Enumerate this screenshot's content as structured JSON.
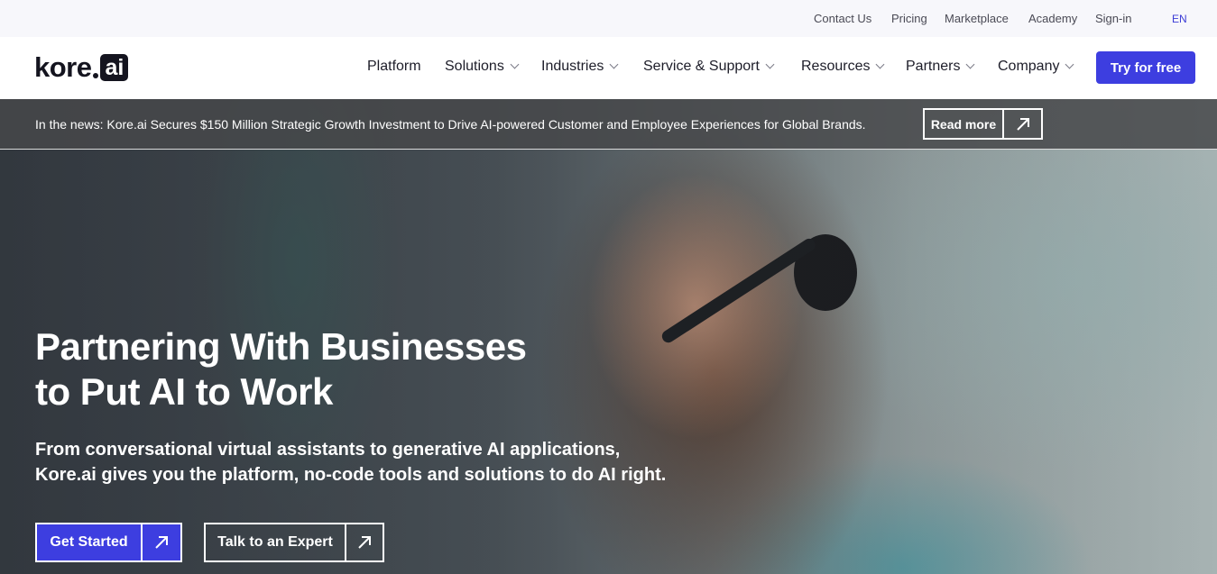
{
  "utility_nav": {
    "contact": "Contact Us",
    "pricing": "Pricing",
    "marketplace": "Marketplace",
    "academy": "Academy",
    "signin": "Sign-in",
    "language": "EN"
  },
  "header": {
    "logo": {
      "brand": "kore",
      "suffix": "ai"
    },
    "nav": {
      "platform": "Platform",
      "solutions": "Solutions",
      "industries": "Industries",
      "service_support": "Service & Support",
      "resources": "Resources",
      "partners": "Partners",
      "company": "Company"
    },
    "cta": "Try for free"
  },
  "news": {
    "text": "In the news: Kore.ai Secures $150 Million Strategic Growth Investment to Drive AI-powered Customer and Employee Experiences for Global Brands.",
    "button": "Read more"
  },
  "hero": {
    "title_line1": "Partnering With Businesses",
    "title_line2": "to Put AI to Work",
    "subtitle_line1": "From conversational virtual assistants to generative AI applications,",
    "subtitle_line2": "Kore.ai gives you the platform, no-code tools and solutions to do AI right.",
    "primary_button": "Get Started",
    "secondary_button": "Talk to an Expert"
  },
  "colors": {
    "accent": "#3d3ee0",
    "text_dark": "#1d1d29",
    "utility_bg": "#f7f7fb"
  },
  "icons": {
    "nav_dropdown": "chevron-down-icon",
    "button_arrow": "arrow-up-right-icon"
  }
}
